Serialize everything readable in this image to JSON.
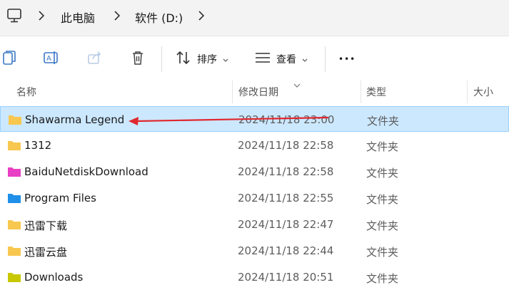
{
  "address": {
    "root_icon": "monitor-icon",
    "crumbs": [
      "此电脑",
      "软件 (D:)"
    ]
  },
  "toolbar": {
    "copy_icon": "copy-icon",
    "rename_icon": "rename-icon",
    "share_icon": "share-icon",
    "delete_icon": "trash-icon",
    "sort_label": "排序",
    "view_label": "查看",
    "more_label": "•••"
  },
  "columns": {
    "name": "名称",
    "date": "修改日期",
    "type": "类型",
    "size": "大小"
  },
  "files": [
    {
      "name": "Shawarma Legend",
      "date": "2024/11/18 23:00",
      "type": "文件夹",
      "folder_color": "#f8c74f",
      "selected": true
    },
    {
      "name": "1312",
      "date": "2024/11/18 22:58",
      "type": "文件夹",
      "folder_color": "#f8c74f",
      "selected": false
    },
    {
      "name": "BaiduNetdiskDownload",
      "date": "2024/11/18 22:58",
      "type": "文件夹",
      "folder_color": "#e83fc4",
      "selected": false
    },
    {
      "name": "Program Files",
      "date": "2024/11/18 22:55",
      "type": "文件夹",
      "folder_color": "#1f8fe8",
      "selected": false
    },
    {
      "name": "迅雷下载",
      "date": "2024/11/18 22:47",
      "type": "文件夹",
      "folder_color": "#f8c74f",
      "selected": false
    },
    {
      "name": "迅雷云盘",
      "date": "2024/11/18 22:44",
      "type": "文件夹",
      "folder_color": "#f8c74f",
      "selected": false
    },
    {
      "name": "Downloads",
      "date": "2024/11/18 20:51",
      "type": "文件夹",
      "folder_color": "#c8c800",
      "selected": false
    }
  ],
  "colors": {
    "selection_bg": "#cce8ff",
    "selection_border": "#99d1ff",
    "annotation_arrow": "#e0282e"
  }
}
